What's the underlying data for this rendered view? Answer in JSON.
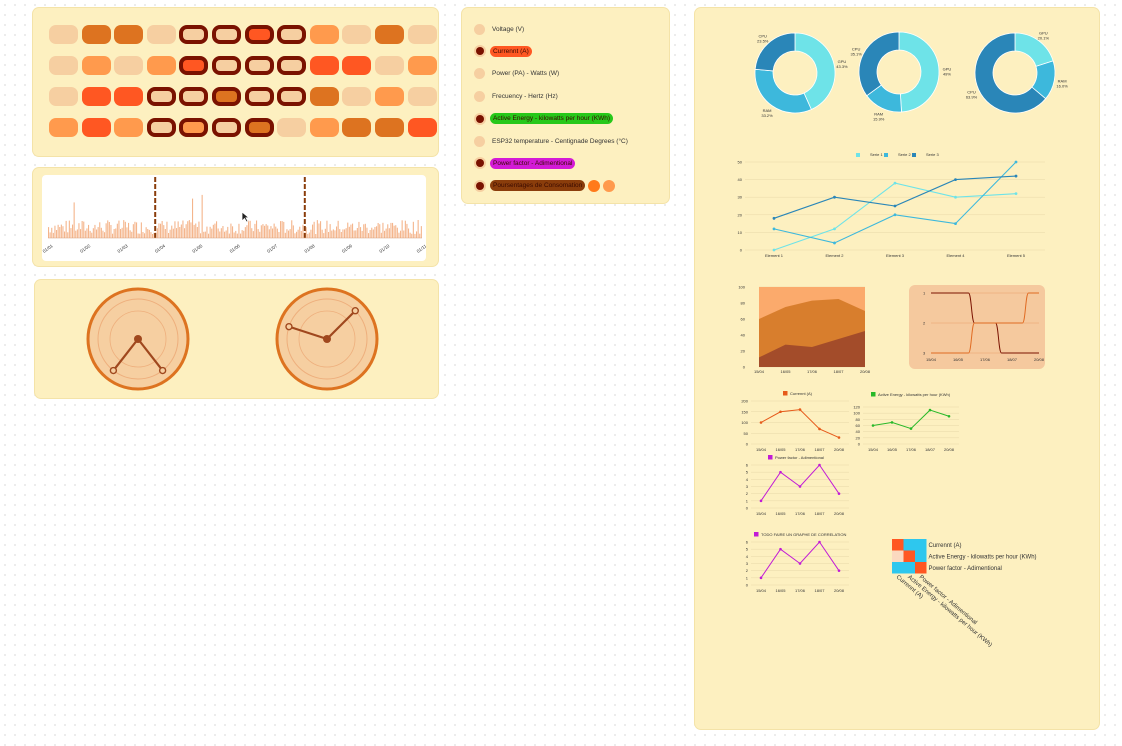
{
  "colors": {
    "panel": "#fdf0c0",
    "pill_light": "#f6cfa1",
    "pill_mid": "#ff9a4d",
    "pill_orange": "#dd7320",
    "pill_red": "#ff5722",
    "pill_selected_border": "#7a1200",
    "cyan": "#6ee3e8",
    "sky": "#3db8dc",
    "blue": "#2a86b8",
    "line_orange": "#e65a1a",
    "line_green": "#27b828",
    "line_magenta": "#c21ad6"
  },
  "pill_grid": {
    "rows": [
      [
        {
          "color": "#f6cfa1",
          "selected": false
        },
        {
          "color": "#dd7320",
          "selected": false
        },
        {
          "color": "#dd7320",
          "selected": false
        },
        {
          "color": "#f6cfa1",
          "selected": false
        },
        {
          "color": "#f6cfa1",
          "selected": true
        },
        {
          "color": "#f6cfa1",
          "selected": true
        },
        {
          "color": "#ff5722",
          "selected": true
        },
        {
          "color": "#f6cfa1",
          "selected": true
        },
        {
          "color": "#ff9a4d",
          "selected": false
        },
        {
          "color": "#f6cfa1",
          "selected": false
        },
        {
          "color": "#dd7320",
          "selected": false
        },
        {
          "color": "#f6cfa1",
          "selected": false
        }
      ],
      [
        {
          "color": "#f6cfa1",
          "selected": false
        },
        {
          "color": "#ff9a4d",
          "selected": false
        },
        {
          "color": "#f6cfa1",
          "selected": false
        },
        {
          "color": "#ff9a4d",
          "selected": false
        },
        {
          "color": "#ff5722",
          "selected": true
        },
        {
          "color": "#f6cfa1",
          "selected": true
        },
        {
          "color": "#f6cfa1",
          "selected": true
        },
        {
          "color": "#f6cfa1",
          "selected": true
        },
        {
          "color": "#ff5722",
          "selected": false
        },
        {
          "color": "#ff5722",
          "selected": false
        },
        {
          "color": "#f6cfa1",
          "selected": false
        },
        {
          "color": "#ff9a4d",
          "selected": false
        }
      ],
      [
        {
          "color": "#f6cfa1",
          "selected": false
        },
        {
          "color": "#ff5722",
          "selected": false
        },
        {
          "color": "#ff5722",
          "selected": false
        },
        {
          "color": "#f6cfa1",
          "selected": true
        },
        {
          "color": "#f6cfa1",
          "selected": true
        },
        {
          "color": "#dd7320",
          "selected": true
        },
        {
          "color": "#f6cfa1",
          "selected": true
        },
        {
          "color": "#f6cfa1",
          "selected": true
        },
        {
          "color": "#dd7320",
          "selected": false
        },
        {
          "color": "#f6cfa1",
          "selected": false
        },
        {
          "color": "#ff9a4d",
          "selected": false
        },
        {
          "color": "#f6cfa1",
          "selected": false
        }
      ],
      [
        {
          "color": "#ff9a4d",
          "selected": false
        },
        {
          "color": "#ff5722",
          "selected": false
        },
        {
          "color": "#ff9a4d",
          "selected": false
        },
        {
          "color": "#f6cfa1",
          "selected": true
        },
        {
          "color": "#ff9a4d",
          "selected": true
        },
        {
          "color": "#f6cfa1",
          "selected": true
        },
        {
          "color": "#dd7320",
          "selected": true
        },
        {
          "color": "#f6cfa1",
          "selected": false
        },
        {
          "color": "#ff9a4d",
          "selected": false
        },
        {
          "color": "#dd7320",
          "selected": false
        },
        {
          "color": "#dd7320",
          "selected": false
        },
        {
          "color": "#ff5722",
          "selected": false
        }
      ]
    ]
  },
  "histogram": {
    "x_ticks": [
      "01/01",
      "01/02",
      "01/03",
      "01/04",
      "01/05",
      "01/06",
      "01/07",
      "01/08",
      "01/09",
      "01/10",
      "01/11"
    ],
    "markers": [
      "01/04",
      "01/08"
    ]
  },
  "gauges": [
    {
      "name": "gauge-left",
      "angles": [
        218,
        142
      ]
    },
    {
      "name": "gauge-right",
      "angles": [
        288,
        45
      ]
    }
  ],
  "legend": {
    "items": [
      {
        "label": "Voltage (V)",
        "active": false,
        "highlight": ""
      },
      {
        "label": "Currennt (A)",
        "active": true,
        "highlight": "#ff5722"
      },
      {
        "label": "Power (PA) - Watts (W)",
        "active": false,
        "highlight": ""
      },
      {
        "label": "Frecuency - Hertz (Hz)",
        "active": false,
        "highlight": ""
      },
      {
        "label": "Active Energy - kilowatts per hour (KWh)",
        "active": true,
        "highlight": "#27c81a"
      },
      {
        "label": "ESP32 temperature - Centignade Degrees (°C)",
        "active": false,
        "highlight": ""
      },
      {
        "label": "Power factor - Adimentional",
        "active": true,
        "highlight": "#d31ad6"
      },
      {
        "label": "Poursentages de Consomation",
        "active": true,
        "highlight": "#8a3d0b"
      }
    ]
  },
  "chart_data": [
    {
      "type": "pie",
      "name": "donut-1",
      "values": [
        43.3,
        33.2,
        23.5
      ],
      "labels": [
        "GPU\n43.3%",
        "RAM\n33.2%",
        "CPU\n23.5%"
      ],
      "colors": [
        "#6ee3e8",
        "#3db8dc",
        "#2a86b8"
      ]
    },
    {
      "type": "pie",
      "name": "donut-2",
      "values": [
        49,
        15.9,
        35.1
      ],
      "labels": [
        "GPU\n49%",
        "RAM\n15.9%",
        "CPU\n35.1%"
      ],
      "colors": [
        "#6ee3e8",
        "#3db8dc",
        "#2a86b8"
      ]
    },
    {
      "type": "pie",
      "name": "donut-3",
      "values": [
        20.1,
        16,
        63.9
      ],
      "labels": [
        "GPU\n20.1%",
        "RAM\n16.0%",
        "CPU\n63.9%"
      ],
      "colors": [
        "#6ee3e8",
        "#3db8dc",
        "#2a86b8"
      ]
    },
    {
      "type": "line",
      "name": "series-chart",
      "categories": [
        "Element 1",
        "Element 2",
        "Element 3",
        "Element 4",
        "Element 5"
      ],
      "ylim": [
        0,
        50
      ],
      "yticks": [
        0,
        10,
        20,
        30,
        40,
        50
      ],
      "series": [
        {
          "name": "Serie 1",
          "color": "#6ee3e8",
          "values": [
            0,
            12,
            38,
            30,
            32
          ]
        },
        {
          "name": "Serie 2",
          "color": "#3db8dc",
          "values": [
            12,
            4,
            20,
            15,
            50
          ]
        },
        {
          "name": "Serie 3",
          "color": "#2a86b8",
          "values": [
            18,
            30,
            25,
            40,
            42
          ]
        }
      ]
    },
    {
      "type": "area",
      "name": "stacked-area",
      "categories": [
        "15/04",
        "16/05",
        "17/06",
        "18/07",
        "20/08"
      ],
      "ylim": [
        0,
        100
      ],
      "yticks": [
        0,
        20,
        40,
        60,
        80,
        100
      ],
      "series": [
        {
          "color": "#a04a2a",
          "values": [
            12,
            28,
            25,
            35,
            45
          ]
        },
        {
          "color": "#d67b2a",
          "values": [
            60,
            75,
            83,
            85,
            70
          ]
        },
        {
          "color": "#fba567",
          "values": [
            100,
            100,
            100,
            100,
            100
          ]
        }
      ]
    },
    {
      "type": "line",
      "name": "step-chart",
      "categories": [
        "15/04",
        "16/05",
        "17/06",
        "18/07",
        "20/08"
      ],
      "yticks": [
        1,
        2,
        3
      ],
      "ylim": [
        1,
        3
      ],
      "series": [
        {
          "color": "#7a1200",
          "values": [
            1,
            1,
            2,
            3,
            3
          ]
        },
        {
          "color": "#e06b22",
          "values": [
            3,
            3,
            2,
            2,
            1
          ]
        }
      ]
    },
    {
      "type": "line",
      "name": "current-chart",
      "title": "Currennt (A)",
      "color": "#e65a1a",
      "categories": [
        "15/04",
        "16/05",
        "17/06",
        "18/07",
        "20/08"
      ],
      "ylim": [
        0,
        200
      ],
      "yticks": [
        0,
        50,
        100,
        150,
        200
      ],
      "values": [
        100,
        150,
        160,
        70,
        30
      ]
    },
    {
      "type": "line",
      "name": "energy-chart",
      "title": "Active Energy - kilowatts per hour (KWh)",
      "color": "#27b828",
      "categories": [
        "15/04",
        "16/05",
        "17/06",
        "18/07",
        "20/08"
      ],
      "ylim": [
        0,
        120
      ],
      "yticks": [
        0,
        20,
        40,
        60,
        80,
        100,
        120
      ],
      "values": [
        60,
        70,
        50,
        110,
        90
      ]
    },
    {
      "type": "line",
      "name": "power-factor-chart",
      "title": "Power factor - Adimentional",
      "color": "#c21ad6",
      "categories": [
        "15/04",
        "16/05",
        "17/06",
        "18/07",
        "20/08"
      ],
      "ylim": [
        0,
        6
      ],
      "yticks": [
        0,
        1,
        2,
        3,
        4,
        5,
        6
      ],
      "values": [
        1,
        5,
        3,
        6,
        2
      ]
    },
    {
      "type": "line",
      "name": "correlation-chart",
      "title": "TODO FAIRE UN GRAPHE DE CORRELATION",
      "color": "#c21ad6",
      "categories": [
        "15/04",
        "16/05",
        "17/06",
        "18/07",
        "20/08"
      ],
      "ylim": [
        0,
        6
      ],
      "yticks": [
        0,
        1,
        2,
        3,
        4,
        5,
        6
      ],
      "values": [
        1,
        5,
        3,
        6,
        2
      ]
    },
    {
      "type": "heatmap",
      "name": "correlation-matrix",
      "labels": [
        "Currennt (A)",
        "Active Energy - kilowatts per hour (KWh)",
        "Power factor - Adimentional"
      ],
      "cells": [
        [
          "#ff5722",
          "#2ec7ee",
          "#2ec7ee"
        ],
        [
          "#fbd9c0",
          "#ff5722",
          "#2ec7ee"
        ],
        [
          "#2ec7ee",
          "#2ec7ee",
          "#ff5722"
        ]
      ]
    }
  ]
}
